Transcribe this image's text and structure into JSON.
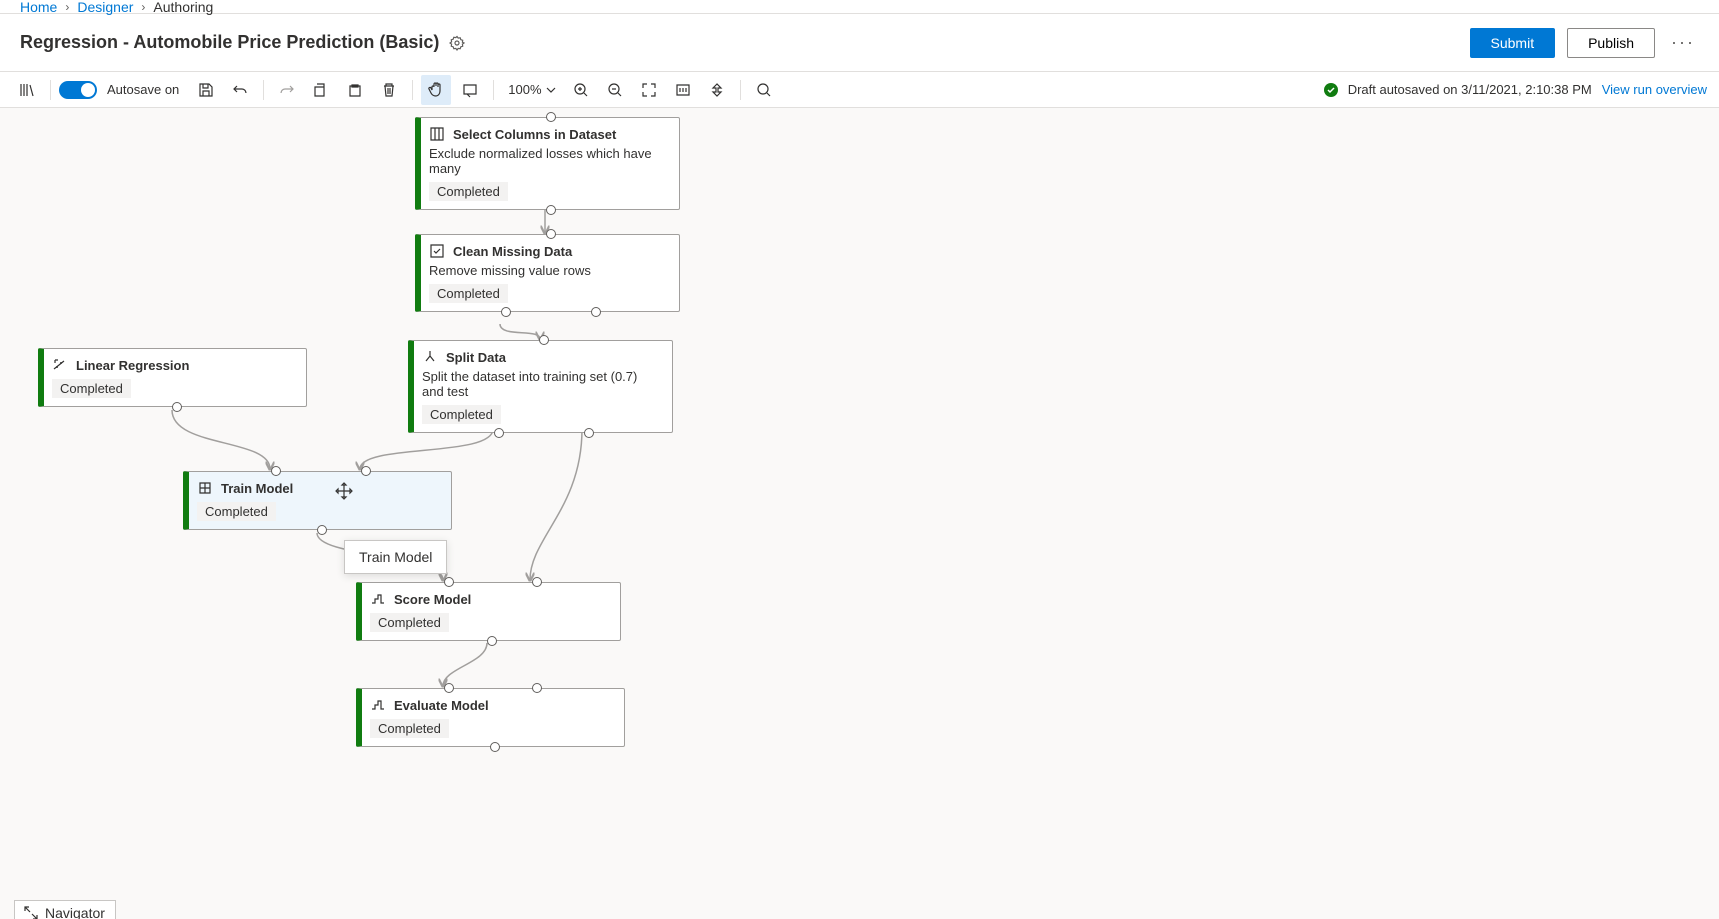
{
  "breadcrumb": {
    "home": "Home",
    "designer": "Designer",
    "authoring": "Authoring"
  },
  "page": {
    "title": "Regression - Automobile Price Prediction (Basic)"
  },
  "actions": {
    "submit": "Submit",
    "publish": "Publish"
  },
  "toolbar": {
    "autosave_label": "Autosave on",
    "zoom": "100%"
  },
  "status": {
    "text": "Draft autosaved on 3/11/2021, 2:10:38 PM",
    "view_link": "View run overview"
  },
  "nodes": {
    "select_columns": {
      "title": "Select Columns in Dataset",
      "desc": "Exclude normalized losses which have many",
      "status": "Completed"
    },
    "clean_missing": {
      "title": "Clean Missing Data",
      "desc": "Remove missing value rows",
      "status": "Completed"
    },
    "split_data": {
      "title": "Split Data",
      "desc": "Split the dataset into training set (0.7) and test",
      "status": "Completed"
    },
    "linear_regression": {
      "title": "Linear Regression",
      "status": "Completed"
    },
    "train_model": {
      "title": "Train Model",
      "status": "Completed"
    },
    "score_model": {
      "title": "Score Model",
      "status": "Completed"
    },
    "evaluate_model": {
      "title": "Evaluate Model",
      "status": "Completed"
    }
  },
  "tooltip": {
    "train_model": "Train Model"
  },
  "navigator": {
    "label": "Navigator"
  }
}
